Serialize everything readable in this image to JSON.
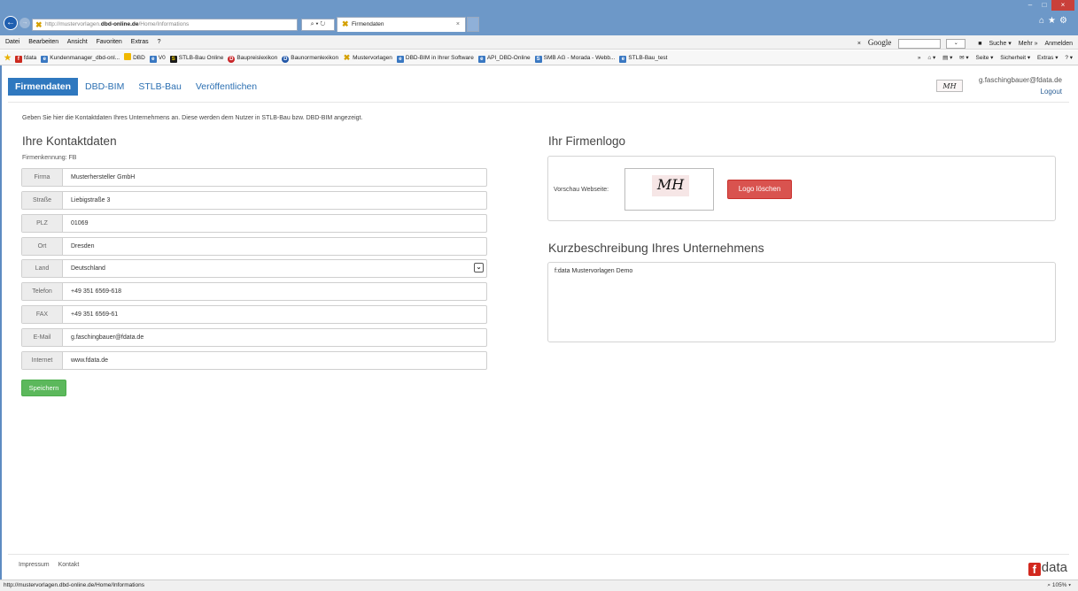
{
  "browser": {
    "url_prefix": "http://mustervorlagen.",
    "url_domain": "dbd-online.de",
    "url_path": "/Home/Informations",
    "addr_tools": "⌕ ▾ ↻",
    "tab_title": "Firmendaten",
    "tab_close": "×",
    "back_icon": "←",
    "forward_icon": "→",
    "window_buttons": [
      "–",
      "□",
      "×"
    ],
    "chrome_icons": "⌂★⚙",
    "menu": [
      "Datei",
      "Bearbeiten",
      "Ansicht",
      "Favoriten",
      "Extras",
      "?"
    ],
    "google_close": "×",
    "google_logo": "Google",
    "google_drop": "⌄",
    "search_label": "Suche ▾",
    "mehr_label": "Mehr »",
    "login_label": "Anmelden",
    "favorites": [
      {
        "label": "fdata",
        "icon": "red",
        "glyph": "f"
      },
      {
        "label": "Kundenmanager_dbd-onl...",
        "icon": "blue",
        "glyph": "e"
      },
      {
        "label": "DBD",
        "icon": "yellow",
        "glyph": ""
      },
      {
        "label": "V0",
        "icon": "blue",
        "glyph": "e"
      },
      {
        "label": "STLB-Bau Online",
        "icon": "dark",
        "glyph": "S"
      },
      {
        "label": "Baupreislexikon",
        "icon": "circle-r",
        "glyph": "D"
      },
      {
        "label": "Baunormenlexikon",
        "icon": "circle",
        "glyph": "D"
      },
      {
        "label": "Mustervorlagen",
        "icon": "x",
        "glyph": "✖"
      },
      {
        "label": "DBD-BIM in Ihrer Software",
        "icon": "blue",
        "glyph": "e"
      },
      {
        "label": "API_DBD-Online",
        "icon": "blue",
        "glyph": "e"
      },
      {
        "label": "SMB AG - Morada - Webb...",
        "icon": "blue",
        "glyph": "S"
      },
      {
        "label": "STLB-Bau_test",
        "icon": "blue",
        "glyph": "e"
      }
    ],
    "fav_more": "»",
    "commands": [
      "⌂ ▾",
      "▤ ▾",
      "✉ ▾",
      "Seite ▾",
      "Sicherheit ▾",
      "Extras ▾",
      "? ▾"
    ],
    "status_url": "http://mustervorlagen.dbd-online.de/Home/Informations",
    "zoom": "⌕ 105% ▾"
  },
  "nav": {
    "items": [
      "Firmendaten",
      "DBD-BIM",
      "STLB-Bau",
      "Veröffentlichen"
    ],
    "active": "Firmendaten"
  },
  "user": {
    "logo_text": "MH",
    "email": "g.faschingbauer@fdata.de",
    "logout": "Logout"
  },
  "intro": "Geben Sie hier die Kontaktdaten Ihres Unternehmens an. Diese werden dem Nutzer in STLB-Bau bzw. DBD-BIM angezeigt.",
  "contact": {
    "heading": "Ihre Kontaktdaten",
    "kennung": "Firmenkennung: FB",
    "fields": [
      {
        "label": "Firma",
        "value": "Musterhersteller GmbH"
      },
      {
        "label": "Straße",
        "value": "Liebigstraße 3"
      },
      {
        "label": "PLZ",
        "value": "01069"
      },
      {
        "label": "Ort",
        "value": "Dresden"
      },
      {
        "label": "Land",
        "value": "Deutschland"
      },
      {
        "label": "Telefon",
        "value": "+49 351 6569-618"
      },
      {
        "label": "FAX",
        "value": "+49 351 6569-61"
      },
      {
        "label": "E-Mail",
        "value": "g.faschingbauer@fdata.de"
      },
      {
        "label": "Internet",
        "value": "www.fdata.de"
      }
    ],
    "select_arrow": "⌄",
    "save": "Speichern"
  },
  "logo": {
    "heading": "Ihr Firmenlogo",
    "preview_label": "Vorschau Webseite:",
    "preview_text": "MH",
    "delete": "Logo löschen"
  },
  "description": {
    "heading": "Kurzbeschreibung Ihres Unternehmens",
    "text": "f:data Mustervorlagen Demo"
  },
  "footer": {
    "links": [
      "Impressum",
      "Kontakt"
    ],
    "brand_f": "f",
    "brand_rest": "data"
  }
}
